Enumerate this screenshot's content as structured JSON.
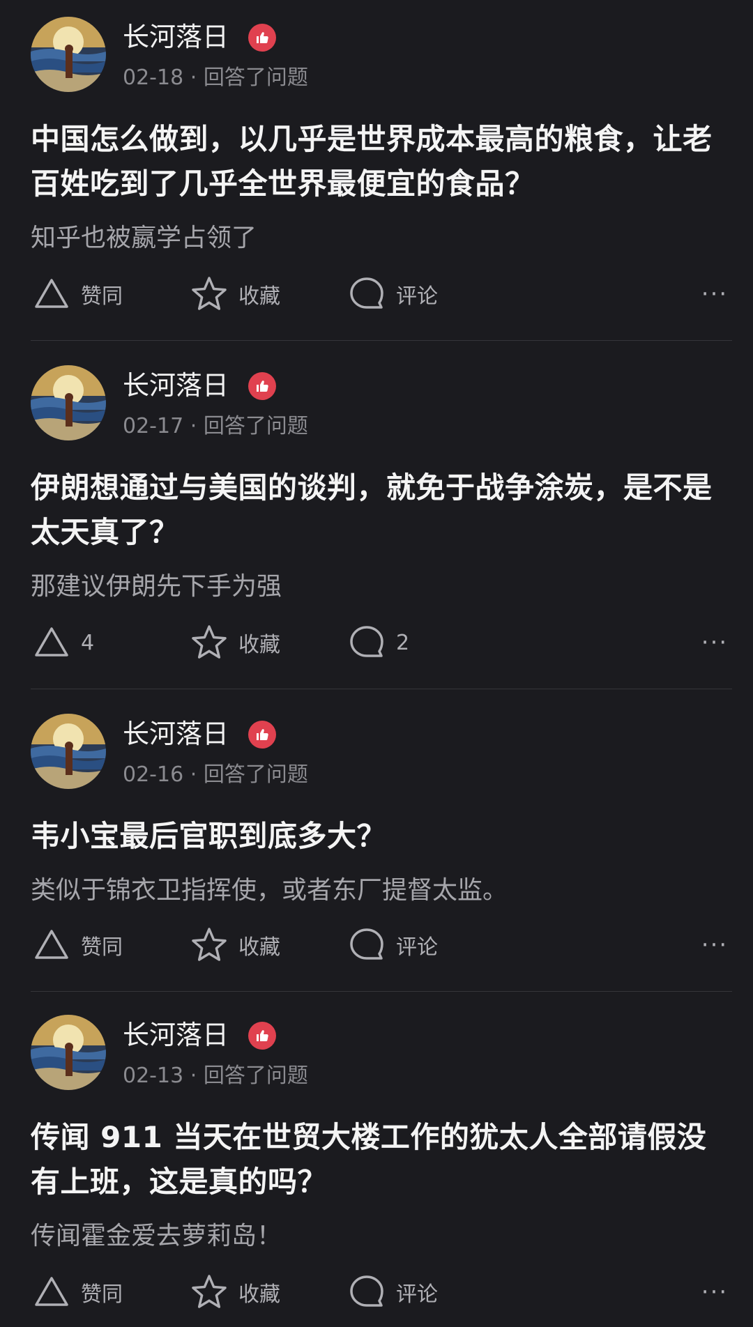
{
  "colors": {
    "background": "#1b1b1f",
    "badge": "#e0414f",
    "text_primary": "#f4f4f4",
    "text_secondary": "#8b8b90",
    "divider": "#35353a"
  },
  "icons": {
    "vote": "triangle-up-icon",
    "favorite": "star-icon",
    "comment": "speech-bubble-icon",
    "more": "ellipsis-icon",
    "badge": "thumbs-up-badge-icon"
  },
  "posts": [
    {
      "author": "长河落日",
      "date": "02-18",
      "action_text": "回答了问题",
      "separator": "·",
      "title": "中国怎么做到，以几乎是世界成本最高的粮食，让老百姓吃到了几乎全世界最便宜的食品？",
      "excerpt": "知乎也被嬴学占领了",
      "vote_label": "赞同",
      "favorite_label": "收藏",
      "comment_label": "评论",
      "more_label": "···"
    },
    {
      "author": "长河落日",
      "date": "02-17",
      "action_text": "回答了问题",
      "separator": "·",
      "title": "伊朗想通过与美国的谈判，就免于战争涂炭，是不是太天真了？",
      "excerpt": "那建议伊朗先下手为强",
      "vote_label": "4",
      "favorite_label": "收藏",
      "comment_label": "2",
      "more_label": "···"
    },
    {
      "author": "长河落日",
      "date": "02-16",
      "action_text": "回答了问题",
      "separator": "·",
      "title": "韦小宝最后官职到底多大？",
      "excerpt": "类似于锦衣卫指挥使，或者东厂提督太监。",
      "vote_label": "赞同",
      "favorite_label": "收藏",
      "comment_label": "评论",
      "more_label": "···"
    },
    {
      "author": "长河落日",
      "date": "02-13",
      "action_text": "回答了问题",
      "separator": "·",
      "title": "传闻 911 当天在世贸大楼工作的犹太人全部请假没有上班，这是真的吗？",
      "excerpt": "传闻霍金爱去萝莉岛！",
      "vote_label": "赞同",
      "favorite_label": "收藏",
      "comment_label": "评论",
      "more_label": "···"
    }
  ]
}
